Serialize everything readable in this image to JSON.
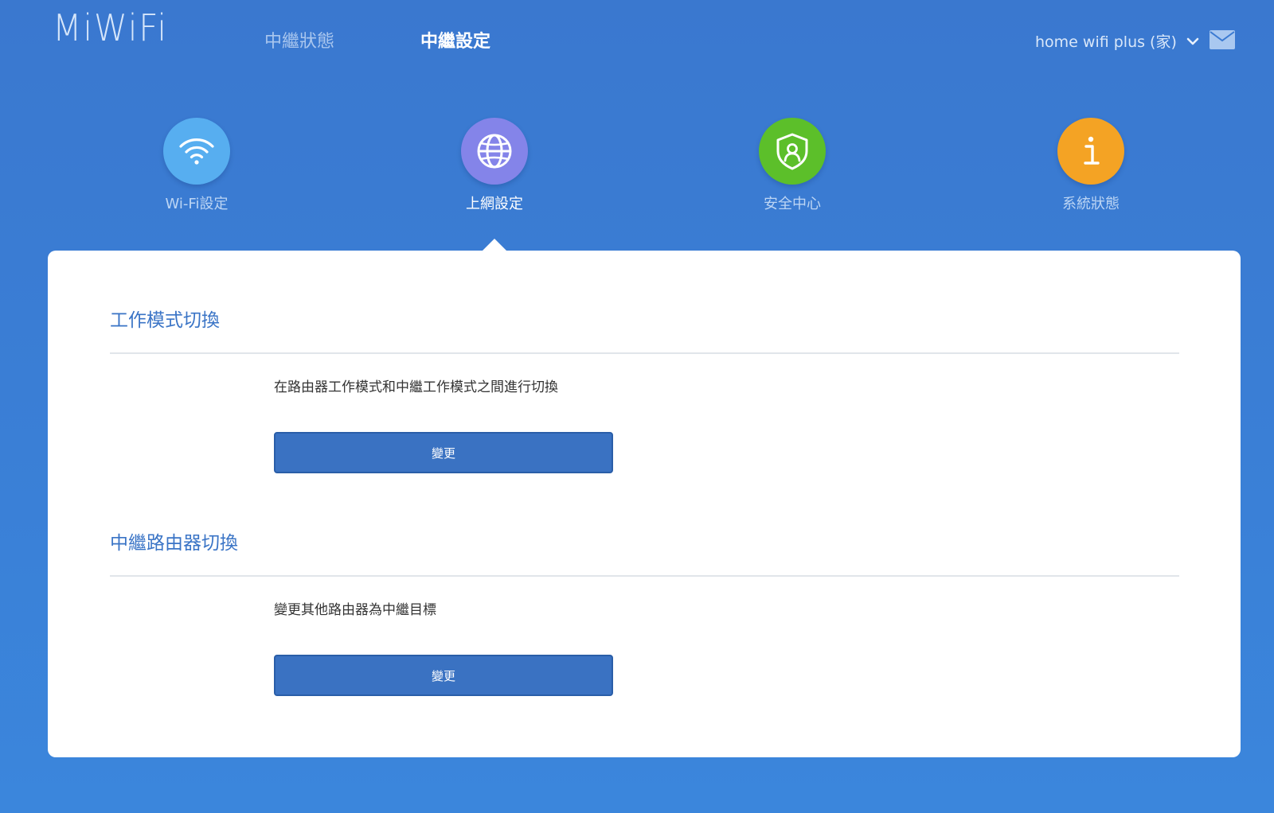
{
  "header": {
    "logo": "MiWiFi",
    "nav": [
      {
        "label": "中繼狀態",
        "active": false
      },
      {
        "label": "中繼設定",
        "active": true
      }
    ],
    "router_name": "home  wifi  plus (家)",
    "icons": {
      "dropdown": "chevron-down-icon",
      "mail": "mail-icon"
    }
  },
  "features": [
    {
      "label": "Wi-Fi設定",
      "icon": "wifi-icon",
      "color": "#57aef0",
      "active": false
    },
    {
      "label": "上網設定",
      "icon": "globe-icon",
      "color": "#8484e9",
      "active": true
    },
    {
      "label": "安全中心",
      "icon": "shield-user-icon",
      "color": "#5cbf2a",
      "active": false
    },
    {
      "label": "系統狀態",
      "icon": "info-icon",
      "color": "#f4a324",
      "active": false
    }
  ],
  "sections": [
    {
      "title": "工作模式切換",
      "description": "在路由器工作模式和中繼工作模式之間進行切換",
      "button_label": "變更"
    },
    {
      "title": "中繼路由器切換",
      "description": "變更其他路由器為中繼目標",
      "button_label": "變更"
    }
  ],
  "colors": {
    "background": "#3a7fd6",
    "button": "#3a72c2",
    "section_title": "#3a74c6"
  }
}
